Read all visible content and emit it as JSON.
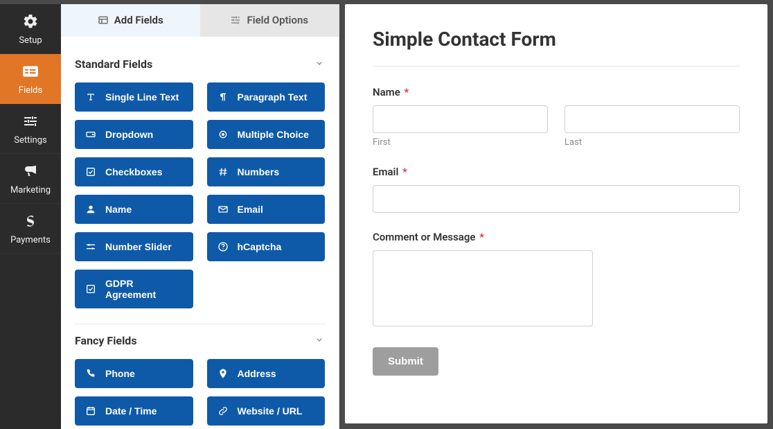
{
  "rail": [
    {
      "id": "setup",
      "label": "Setup",
      "icon": "gear"
    },
    {
      "id": "fields",
      "label": "Fields",
      "icon": "form"
    },
    {
      "id": "settings",
      "label": "Settings",
      "icon": "sliders"
    },
    {
      "id": "marketing",
      "label": "Marketing",
      "icon": "bullhorn"
    },
    {
      "id": "payments",
      "label": "Payments",
      "icon": "dollar"
    }
  ],
  "rail_active": "fields",
  "tabs": {
    "add_fields": "Add Fields",
    "field_options": "Field Options",
    "active": "add_fields"
  },
  "sections": {
    "standard": {
      "title": "Standard Fields",
      "items": [
        {
          "label": "Single Line Text",
          "icon": "text"
        },
        {
          "label": "Paragraph Text",
          "icon": "paragraph"
        },
        {
          "label": "Dropdown",
          "icon": "dropdown"
        },
        {
          "label": "Multiple Choice",
          "icon": "radio"
        },
        {
          "label": "Checkboxes",
          "icon": "checkbox"
        },
        {
          "label": "Numbers",
          "icon": "hash"
        },
        {
          "label": "Name",
          "icon": "user"
        },
        {
          "label": "Email",
          "icon": "mail"
        },
        {
          "label": "Number Slider",
          "icon": "slider"
        },
        {
          "label": "hCaptcha",
          "icon": "help"
        },
        {
          "label": "GDPR Agreement",
          "icon": "checkbox"
        }
      ]
    },
    "fancy": {
      "title": "Fancy Fields",
      "items": [
        {
          "label": "Phone",
          "icon": "phone"
        },
        {
          "label": "Address",
          "icon": "pin"
        },
        {
          "label": "Date / Time",
          "icon": "calendar"
        },
        {
          "label": "Website / URL",
          "icon": "link"
        }
      ]
    }
  },
  "preview": {
    "title": "Simple Contact Form",
    "name_label": "Name",
    "first_sub": "First",
    "last_sub": "Last",
    "email_label": "Email",
    "comment_label": "Comment or Message",
    "submit_label": "Submit",
    "required_glyph": "*"
  }
}
